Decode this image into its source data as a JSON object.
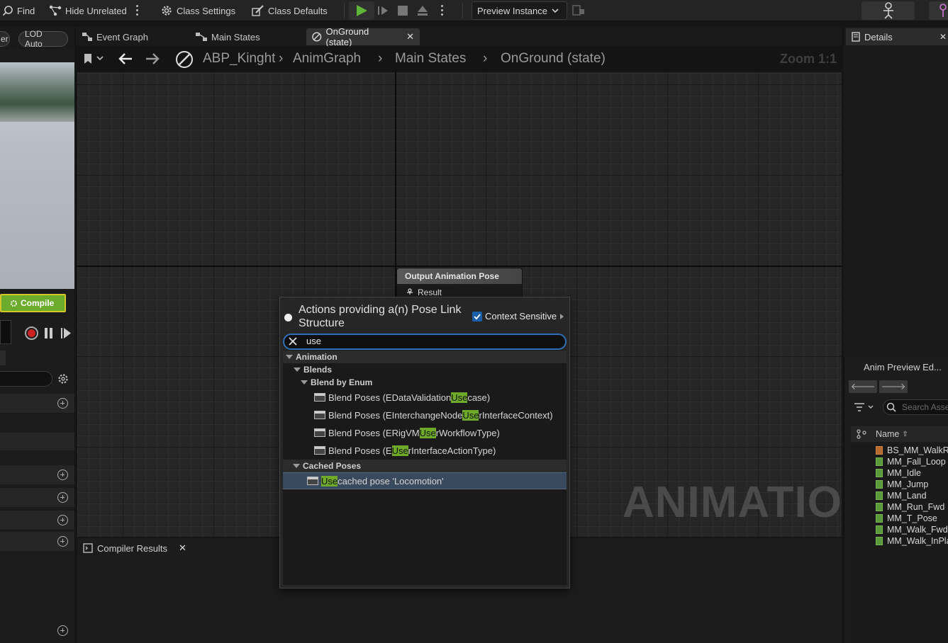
{
  "toolbar": {
    "find_label": "Find",
    "hide_unrelated_label": "Hide Unrelated",
    "class_settings_label": "Class Settings",
    "class_defaults_label": "Class Defaults",
    "preview_instance_label": "Preview Instance"
  },
  "left_panel": {
    "pill_left_label": "er",
    "lod_label": "LOD Auto",
    "compile_label": "Compile"
  },
  "tabs": {
    "event_graph": "Event Graph",
    "main_states": "Main States",
    "onground": "OnGround (state)"
  },
  "breadcrumb": {
    "item_1": "ABP_Kinght",
    "item_2": "AnimGraph",
    "item_3": "Main States",
    "item_4": "OnGround (state)",
    "zoom": "Zoom 1:1"
  },
  "graph": {
    "watermark": "ANIMATION",
    "output_node_title": "Output Animation Pose",
    "output_node_pin": "Result"
  },
  "action_menu": {
    "title": "Actions providing a(n) Pose Link Structure",
    "context_sensitive_label": "Context Sensitive",
    "context_sensitive_checked": true,
    "search_value": "use",
    "category_animation": "Animation",
    "subcategory_blends": "Blends",
    "subcategory_blend_by_enum": "Blend by Enum",
    "subcategory_cached_poses": "Cached Poses",
    "items": [
      {
        "before": "Blend Poses (EDataValidation",
        "match": "Use",
        "after": "case)"
      },
      {
        "before": "Blend Poses (EInterchangeNode",
        "match": "Use",
        "after": "rInterfaceContext)"
      },
      {
        "before": "Blend Poses (ERigVM",
        "match": "Use",
        "after": "rWorkflowType)"
      },
      {
        "before": "Blend Poses (E",
        "match": "Use",
        "after": "rInterfaceActionType)"
      }
    ],
    "cached_item": {
      "before": "",
      "match": "Use",
      "after": " cached pose 'Locomotion'"
    }
  },
  "compiler": {
    "tab_label": "Compiler Results"
  },
  "right_panel": {
    "details_label": "Details",
    "anim_preview_label": "Anim Preview Ed...",
    "search_placeholder": "Search Assets",
    "name_header": "Name",
    "assets": [
      "BS_MM_WalkRun",
      "MM_Fall_Loop",
      "MM_Idle",
      "MM_Jump",
      "MM_Land",
      "MM_Run_Fwd",
      "MM_T_Pose",
      "MM_Walk_Fwd",
      "MM_Walk_InPlace"
    ]
  },
  "colors": {
    "highlight": "#6fa92a",
    "compile_button": "#6bac2c",
    "selection": "#3a4a5e"
  }
}
